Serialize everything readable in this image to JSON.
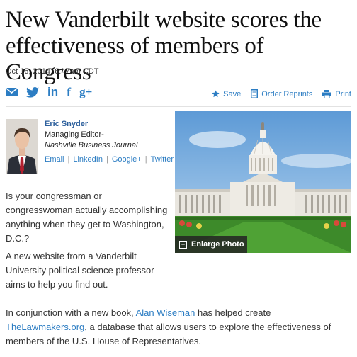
{
  "article": {
    "headline": "New Vanderbilt website scores the effectiveness of members of Congress",
    "dateline": "Oct 16, 2014, 6:47am CDT"
  },
  "share": {
    "email_icon": "email-icon",
    "twitter_icon": "twitter-icon",
    "linkedin_icon": "linkedin-icon",
    "facebook_icon": "facebook-icon",
    "googleplus_icon": "googleplus-icon",
    "linkedin_glyph": "in",
    "facebook_glyph": "f",
    "googleplus_glyph": "g+"
  },
  "tools": {
    "save_label": "Save",
    "order_reprints_label": "Order Reprints",
    "print_label": "Print"
  },
  "author": {
    "name": "Eric Snyder",
    "title": "Managing Editor-",
    "publication": "Nashville Business Journal",
    "links": [
      "Email",
      "LinkedIn",
      "Google+",
      "Twitter"
    ]
  },
  "photo": {
    "enlarge_label": "Enlarge Photo"
  },
  "body": {
    "p1": "Is your congressman or congresswoman actually accomplishing anything when they get to Washington, D.C.?",
    "p2": "A new website from a Vanderbilt University political science professor aims to help you find out.",
    "p3_before": "In conjunction with a new book, ",
    "p3_link1": "Alan Wiseman",
    "p3_middle": " has helped create ",
    "p3_link2": "TheLawmakers.org",
    "p3_after": ", a database that allows users to explore the effectiveness of members of the U.S. House of Representatives."
  },
  "colors": {
    "link": "#2c7dc3",
    "headline": "#111111"
  }
}
